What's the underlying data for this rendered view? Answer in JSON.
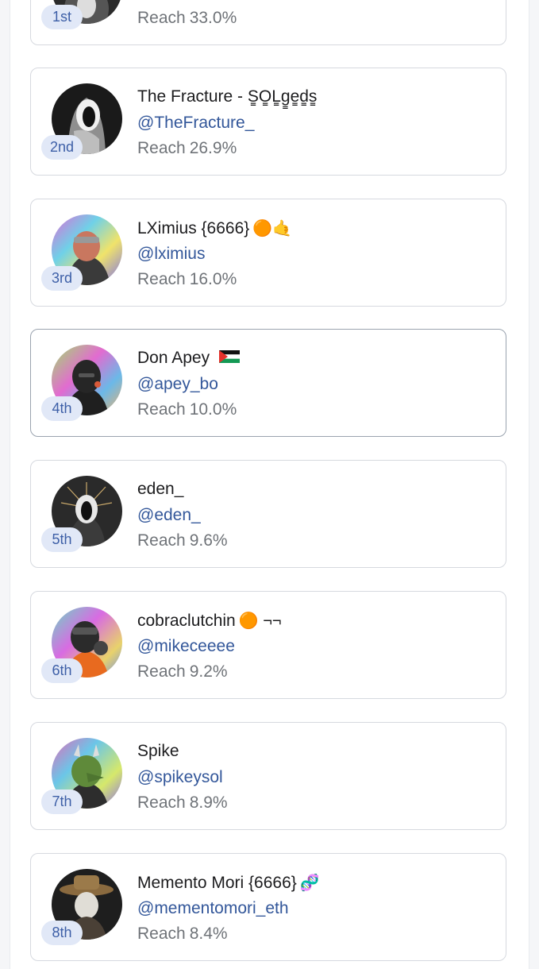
{
  "reach_label": "Reach",
  "entries": [
    {
      "rank": "1st",
      "name": "",
      "handle": "",
      "reach": "33.0%"
    },
    {
      "rank": "2nd",
      "name": "The Fracture - S̳O̳L̳g̳e̳d̳s̳",
      "handle": "@TheFracture_",
      "reach": "26.9%"
    },
    {
      "rank": "3rd",
      "name": "LXimius {6666}",
      "name_emoji": "🟠🤙",
      "handle": "@lximius",
      "reach": "16.0%"
    },
    {
      "rank": "4th",
      "name": "Don Apey",
      "name_emoji": "palestine-flag-icon",
      "handle": "@apey_bo",
      "reach": "10.0%"
    },
    {
      "rank": "5th",
      "name": "eden_",
      "handle": "@eden_",
      "reach": "9.6%"
    },
    {
      "rank": "6th",
      "name": "cobraclutchin",
      "name_emoji": "🟠 ¬¬",
      "handle": "@mikeceeee",
      "reach": "9.2%"
    },
    {
      "rank": "7th",
      "name": "Spike",
      "handle": "@spikeysol",
      "reach": "8.9%"
    },
    {
      "rank": "8th",
      "name": "Memento Mori {6666}",
      "name_emoji": "🧬",
      "handle": "@mementomori_eth",
      "reach": "8.4%"
    }
  ],
  "colors": {
    "rank_badge_bg": "#e1e8f7",
    "rank_badge_text": "#3d5fa7",
    "handle_text": "#33579a",
    "reach_text": "#6f7378",
    "card_border": "#d6d9df"
  }
}
